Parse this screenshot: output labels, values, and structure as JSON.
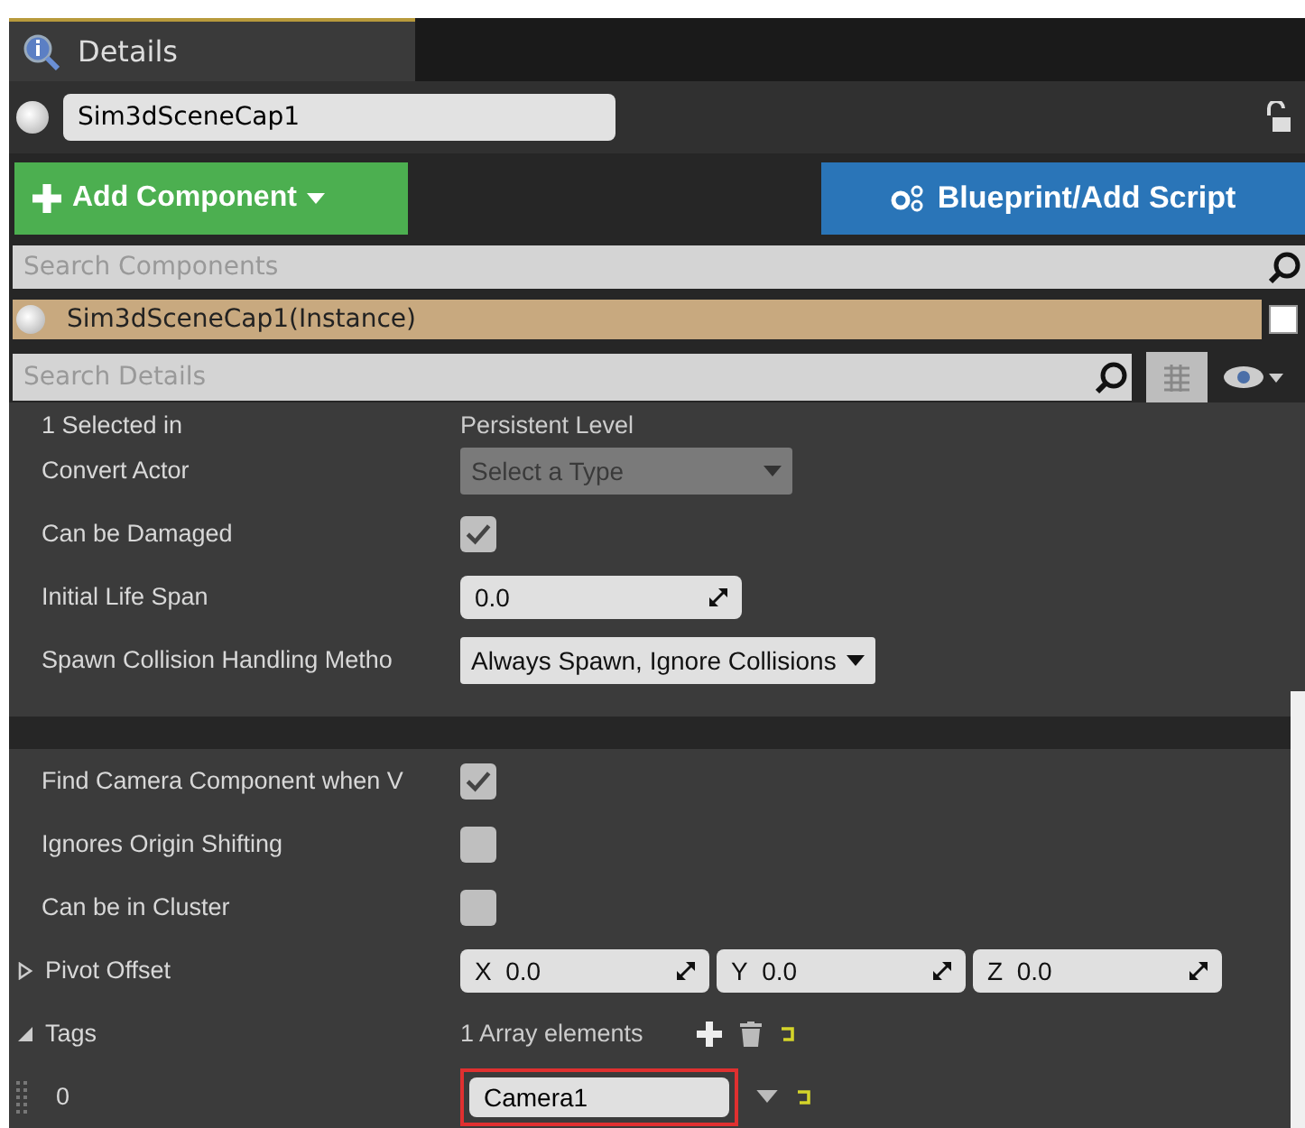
{
  "tab": {
    "label": "Details"
  },
  "actor_name": "Sim3dSceneCap1",
  "add_component": "Add Component",
  "blueprint": "Blueprint/Add Script",
  "search_components": {
    "placeholder": "Search Components"
  },
  "instance": {
    "label": "Sim3dSceneCap1(Instance)",
    "checked": false
  },
  "search_details": {
    "placeholder": "Search Details"
  },
  "sections": [
    {
      "rows": [
        {
          "kind": "text",
          "label": "1 Selected in",
          "value": "Persistent Level"
        },
        {
          "kind": "combo",
          "label": "Convert Actor",
          "value": "Select a Type",
          "disabled": true
        },
        {
          "kind": "checkbox",
          "label": "Can be Damaged",
          "checked": true
        },
        {
          "kind": "number",
          "label": "Initial Life Span",
          "value": "0.0"
        },
        {
          "kind": "combo",
          "label": "Spawn Collision Handling Metho",
          "value": "Always Spawn, Ignore Collisions",
          "disabled": false
        }
      ]
    },
    {
      "rows": [
        {
          "kind": "checkbox",
          "label": "Find Camera Component when V",
          "checked": true
        },
        {
          "kind": "checkbox",
          "label": "Ignores Origin Shifting",
          "checked": false
        },
        {
          "kind": "checkbox",
          "label": "Can be in Cluster",
          "checked": false
        },
        {
          "kind": "vector",
          "label": "Pivot Offset",
          "expanded": false,
          "axes": [
            {
              "axis": "X",
              "value": "0.0"
            },
            {
              "axis": "Y",
              "value": "0.0"
            },
            {
              "axis": "Z",
              "value": "0.0"
            }
          ]
        },
        {
          "kind": "array",
          "label": "Tags",
          "expanded": true,
          "value": "1 Array elements"
        },
        {
          "kind": "element",
          "label": "0",
          "value": "Camera1",
          "highlighted": true
        }
      ]
    }
  ]
}
